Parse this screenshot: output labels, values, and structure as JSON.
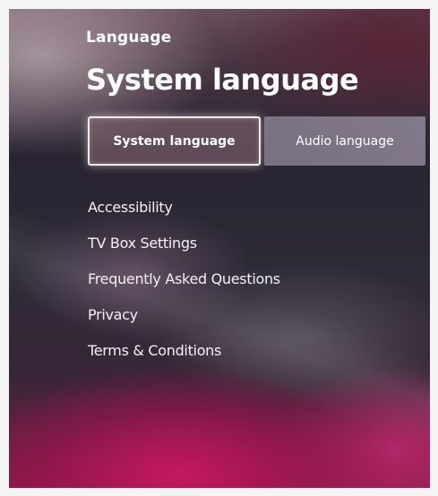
{
  "header": {
    "breadcrumb": "Language",
    "title": "System language"
  },
  "tabs": [
    {
      "label": "System language",
      "selected": true
    },
    {
      "label": "Audio language",
      "selected": false
    }
  ],
  "menu": {
    "items": [
      {
        "label": "Accessibility"
      },
      {
        "label": "TV Box Settings"
      },
      {
        "label": "Frequently Asked Questions"
      },
      {
        "label": "Privacy"
      },
      {
        "label": "Terms & Conditions"
      }
    ]
  },
  "colors": {
    "text": "#ffffff",
    "focus_border": "#f2ece9",
    "background_dark": "#2a2432",
    "background_accent": "#c81860",
    "inactive_tab": "#8c8496"
  }
}
